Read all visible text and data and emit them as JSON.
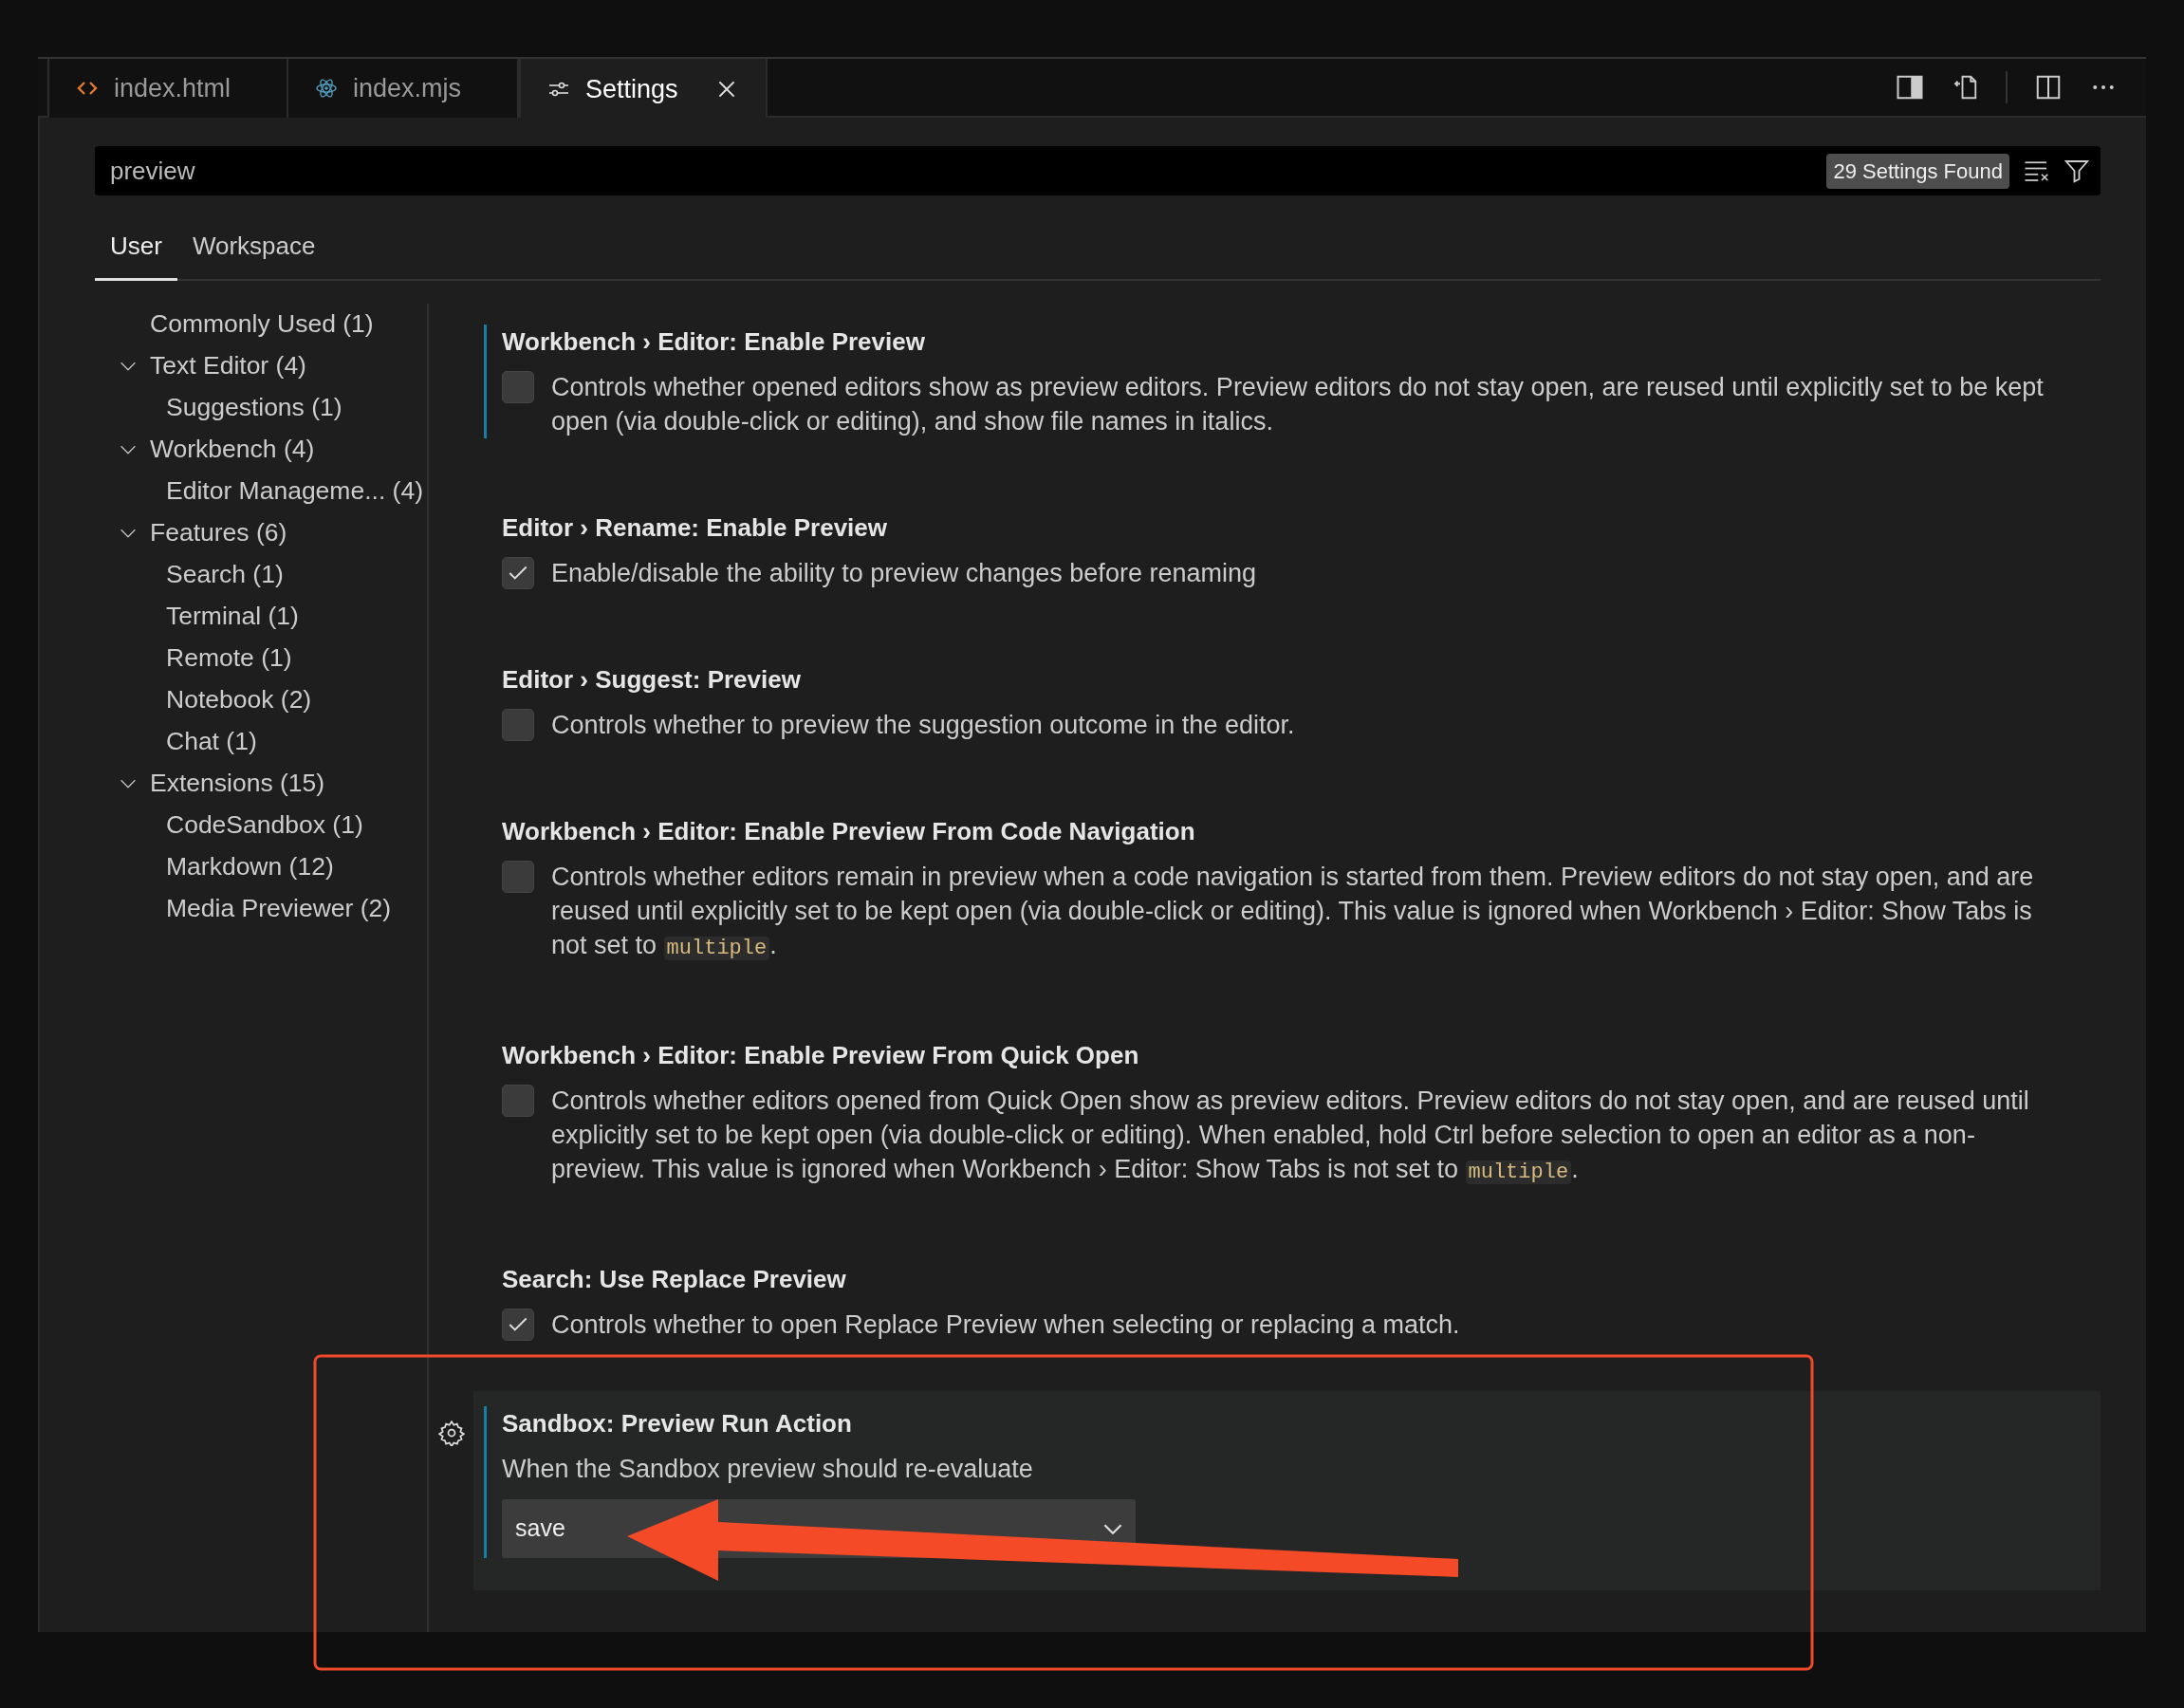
{
  "editor_tabs": [
    {
      "label": "index.html",
      "kind": "html",
      "selected": false,
      "closable": false
    },
    {
      "label": "index.mjs",
      "kind": "react",
      "selected": false,
      "closable": false
    },
    {
      "label": "Settings",
      "kind": "settings",
      "selected": true,
      "closable": true
    }
  ],
  "search": {
    "value": "preview",
    "result_count": "29 Settings Found"
  },
  "scope_tabs": [
    {
      "label": "User",
      "selected": true
    },
    {
      "label": "Workspace",
      "selected": false
    }
  ],
  "sidebar": {
    "items": [
      {
        "label": "Commonly Used (1)"
      },
      {
        "label": "Text Editor (4)",
        "expanded": true,
        "children": [
          {
            "label": "Suggestions (1)"
          }
        ]
      },
      {
        "label": "Workbench (4)",
        "expanded": true,
        "children": [
          {
            "label": "Editor Manageme... (4)"
          }
        ]
      },
      {
        "label": "Features (6)",
        "expanded": true,
        "children": [
          {
            "label": "Search (1)"
          },
          {
            "label": "Terminal (1)"
          },
          {
            "label": "Remote (1)"
          },
          {
            "label": "Notebook (2)"
          },
          {
            "label": "Chat (1)"
          }
        ]
      },
      {
        "label": "Extensions (15)",
        "expanded": true,
        "children": [
          {
            "label": "CodeSandbox (1)"
          },
          {
            "label": "Markdown (12)"
          },
          {
            "label": "Media Previewer (2)"
          }
        ]
      }
    ]
  },
  "settings": [
    {
      "kind": "checkbox",
      "title": "Workbench › Editor: Enable Preview",
      "modified": true,
      "focused": false,
      "checked": false,
      "description": [
        {
          "kind": "text",
          "text": "Controls whether opened editors show as preview editors. Preview editors do not stay open, are reused until explicitly set to be kept open (via double-click or editing), and show file names in italics."
        }
      ]
    },
    {
      "kind": "checkbox",
      "title": "Editor › Rename: Enable Preview",
      "modified": false,
      "focused": false,
      "checked": true,
      "description": [
        {
          "kind": "text",
          "text": "Enable/disable the ability to preview changes before renaming"
        }
      ]
    },
    {
      "kind": "checkbox",
      "title": "Editor › Suggest: Preview",
      "modified": false,
      "focused": false,
      "checked": false,
      "description": [
        {
          "kind": "text",
          "text": "Controls whether to preview the suggestion outcome in the editor."
        }
      ]
    },
    {
      "kind": "checkbox",
      "title": "Workbench › Editor: Enable Preview From Code Navigation",
      "modified": false,
      "focused": false,
      "checked": false,
      "description": [
        {
          "kind": "text",
          "text": "Controls whether editors remain in preview when a code navigation is started from them. Preview editors do not stay open, and are reused until explicitly set to be kept open (via double-click or editing). This value is ignored when Workbench › Editor: Show Tabs is not set to "
        },
        {
          "kind": "code",
          "text": "multiple"
        },
        {
          "kind": "text",
          "text": "."
        }
      ]
    },
    {
      "kind": "checkbox",
      "title": "Workbench › Editor: Enable Preview From Quick Open",
      "modified": false,
      "focused": false,
      "checked": false,
      "description": [
        {
          "kind": "text",
          "text": "Controls whether editors opened from Quick Open show as preview editors. Preview editors do not stay open, and are reused until explicitly set to be kept open (via double-click or editing). When enabled, hold Ctrl before selection to open an editor as a non-preview. This value is ignored when Workbench › Editor: Show Tabs is not set to "
        },
        {
          "kind": "code",
          "text": "multiple"
        },
        {
          "kind": "text",
          "text": "."
        }
      ]
    },
    {
      "kind": "checkbox",
      "title": "Search: Use Replace Preview",
      "modified": false,
      "focused": false,
      "checked": true,
      "description": [
        {
          "kind": "text",
          "text": "Controls whether to open Replace Preview when selecting or replacing a match."
        }
      ]
    },
    {
      "kind": "select",
      "title": "Sandbox: Preview Run Action",
      "modified": true,
      "focused": true,
      "value": "save",
      "description": [
        {
          "kind": "text",
          "text": "When the Sandbox preview should re-evaluate"
        }
      ]
    }
  ],
  "annotations": [
    {
      "kind": "rectangle"
    },
    {
      "kind": "arrow"
    }
  ]
}
